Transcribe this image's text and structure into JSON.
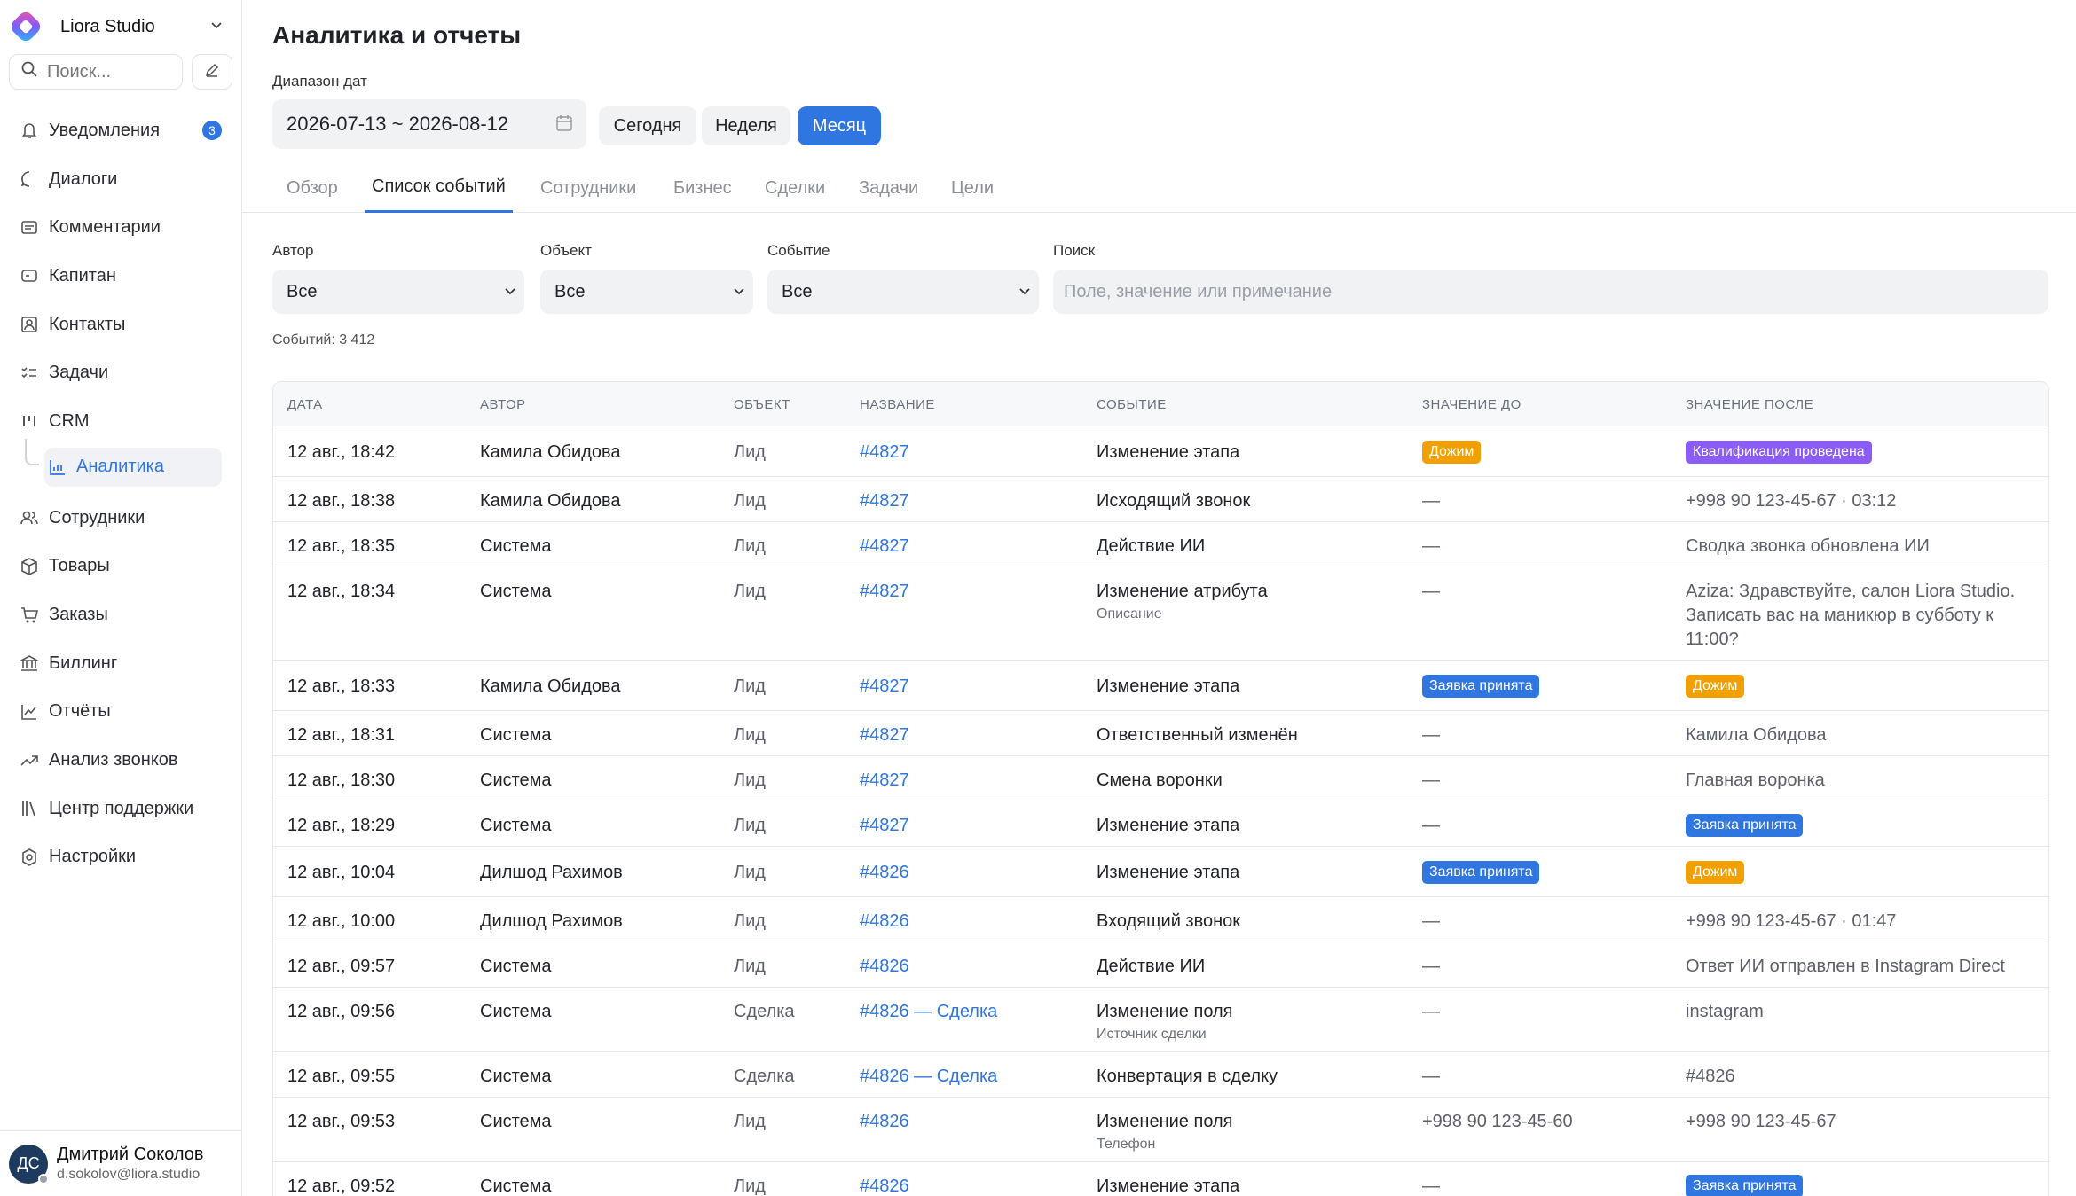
{
  "sidebar": {
    "org_name": "Liora Studio",
    "search_placeholder": "Поиск...",
    "items": [
      {
        "label": "Уведомления",
        "icon": "bell-icon",
        "badge": "3"
      },
      {
        "label": "Диалоги",
        "icon": "chat-icon"
      },
      {
        "label": "Комментарии",
        "icon": "comment-icon"
      },
      {
        "label": "Капитан",
        "icon": "captain-icon"
      },
      {
        "label": "Контакты",
        "icon": "contacts-icon"
      },
      {
        "label": "Задачи",
        "icon": "tasks-icon"
      },
      {
        "label": "CRM",
        "icon": "crm-icon"
      }
    ],
    "sub_item": {
      "label": "Аналитика",
      "icon": "analytics-icon"
    },
    "items_after": [
      {
        "label": "Сотрудники",
        "icon": "users-icon"
      },
      {
        "label": "Товары",
        "icon": "box-icon"
      },
      {
        "label": "Заказы",
        "icon": "cart-icon"
      },
      {
        "label": "Биллинг",
        "icon": "bank-icon"
      },
      {
        "label": "Отчёты",
        "icon": "reports-icon"
      },
      {
        "label": "Анализ звонков",
        "icon": "trend-icon"
      },
      {
        "label": "Центр поддержки",
        "icon": "library-icon"
      },
      {
        "label": "Настройки",
        "icon": "settings-icon"
      }
    ],
    "user": {
      "initials": "ДС",
      "name": "Дмитрий Соколов",
      "email": "d.sokolov@liora.studio"
    }
  },
  "header": {
    "title": "Аналитика и отчеты",
    "date_range_label": "Диапазон дат",
    "date_range_value": "2026-07-13 ~ 2026-08-12",
    "quick": [
      "Сегодня",
      "Неделя",
      "Месяц"
    ],
    "quick_active": "Месяц"
  },
  "tabs": [
    "Обзор",
    "Список событий",
    "Сотрудники",
    "Бизнес",
    "Сделки",
    "Задачи",
    "Цели"
  ],
  "active_tab": "Список событий",
  "filters": {
    "author_label": "Автор",
    "author_value": "Все",
    "object_label": "Объект",
    "object_value": "Все",
    "event_label": "Событие",
    "event_value": "Все",
    "search_label": "Поиск",
    "search_placeholder": "Поле, значение или примечание"
  },
  "events_count": "Событий: 3 412",
  "table": {
    "headers": [
      "ДАТА",
      "АВТОР",
      "ОБЪЕКТ",
      "НАЗВАНИЕ",
      "СОБЫТИЕ",
      "ЗНАЧЕНИЕ ДО",
      "ЗНАЧЕНИЕ ПОСЛЕ"
    ],
    "rows": [
      {
        "date": "12 авг., 18:42",
        "author": "Камила Обидова",
        "object": "Лид",
        "name": "#4827",
        "event": "Изменение этапа",
        "event_sub": "",
        "before": "Дожим",
        "before_tag": "orange",
        "after": "Квалификация проведена",
        "after_tag": "purple"
      },
      {
        "date": "12 авг., 18:38",
        "author": "Камила Обидова",
        "object": "Лид",
        "name": "#4827",
        "event": "Исходящий звонок",
        "event_sub": "",
        "before": "—",
        "before_tag": "",
        "after": "+998 90 123-45-67 · 03:12",
        "after_tag": ""
      },
      {
        "date": "12 авг., 18:35",
        "author": "Система",
        "object": "Лид",
        "name": "#4827",
        "event": "Действие ИИ",
        "event_sub": "",
        "before": "—",
        "before_tag": "",
        "after": "Сводка звонка обновлена ИИ",
        "after_tag": ""
      },
      {
        "date": "12 авг., 18:34",
        "author": "Система",
        "object": "Лид",
        "name": "#4827",
        "event": "Изменение атрибута",
        "event_sub": "Описание",
        "before": "—",
        "before_tag": "",
        "after": "Aziza: Здравствуйте, салон Liora Studio. Записать вас на маникюр в субботу к 11:00?",
        "after_tag": ""
      },
      {
        "date": "12 авг., 18:33",
        "author": "Камила Обидова",
        "object": "Лид",
        "name": "#4827",
        "event": "Изменение этапа",
        "event_sub": "",
        "before": "Заявка принята",
        "before_tag": "blue",
        "after": "Дожим",
        "after_tag": "orange"
      },
      {
        "date": "12 авг., 18:31",
        "author": "Система",
        "object": "Лид",
        "name": "#4827",
        "event": "Ответственный изменён",
        "event_sub": "",
        "before": "—",
        "before_tag": "",
        "after": "Камила Обидова",
        "after_tag": ""
      },
      {
        "date": "12 авг., 18:30",
        "author": "Система",
        "object": "Лид",
        "name": "#4827",
        "event": "Смена воронки",
        "event_sub": "",
        "before": "—",
        "before_tag": "",
        "after": "Главная воронка",
        "after_tag": ""
      },
      {
        "date": "12 авг., 18:29",
        "author": "Система",
        "object": "Лид",
        "name": "#4827",
        "event": "Изменение этапа",
        "event_sub": "",
        "before": "—",
        "before_tag": "",
        "after": "Заявка принята",
        "after_tag": "blue"
      },
      {
        "date": "12 авг., 10:04",
        "author": "Дилшод Рахимов",
        "object": "Лид",
        "name": "#4826",
        "event": "Изменение этапа",
        "event_sub": "",
        "before": "Заявка принята",
        "before_tag": "blue",
        "after": "Дожим",
        "after_tag": "orange"
      },
      {
        "date": "12 авг., 10:00",
        "author": "Дилшод Рахимов",
        "object": "Лид",
        "name": "#4826",
        "event": "Входящий звонок",
        "event_sub": "",
        "before": "—",
        "before_tag": "",
        "after": "+998 90 123-45-67 · 01:47",
        "after_tag": ""
      },
      {
        "date": "12 авг., 09:57",
        "author": "Система",
        "object": "Лид",
        "name": "#4826",
        "event": "Действие ИИ",
        "event_sub": "",
        "before": "—",
        "before_tag": "",
        "after": "Ответ ИИ отправлен в Instagram Direct",
        "after_tag": ""
      },
      {
        "date": "12 авг., 09:56",
        "author": "Система",
        "object": "Сделка",
        "name": "#4826 — Сделка",
        "event": "Изменение поля",
        "event_sub": "Источник сделки",
        "before": "—",
        "before_tag": "",
        "after": "instagram",
        "after_tag": ""
      },
      {
        "date": "12 авг., 09:55",
        "author": "Система",
        "object": "Сделка",
        "name": "#4826 — Сделка",
        "event": "Конвертация в сделку",
        "event_sub": "",
        "before": "—",
        "before_tag": "",
        "after": "#4826",
        "after_tag": ""
      },
      {
        "date": "12 авг., 09:53",
        "author": "Система",
        "object": "Лид",
        "name": "#4826",
        "event": "Изменение поля",
        "event_sub": "Телефон",
        "before": "+998 90 123-45-60",
        "before_tag": "",
        "after": "+998 90 123-45-67",
        "after_tag": ""
      },
      {
        "date": "12 авг., 09:52",
        "author": "Система",
        "object": "Лид",
        "name": "#4826",
        "event": "Изменение этапа",
        "event_sub": "",
        "before": "—",
        "before_tag": "",
        "after": "Заявка принята",
        "after_tag": "blue"
      }
    ]
  }
}
